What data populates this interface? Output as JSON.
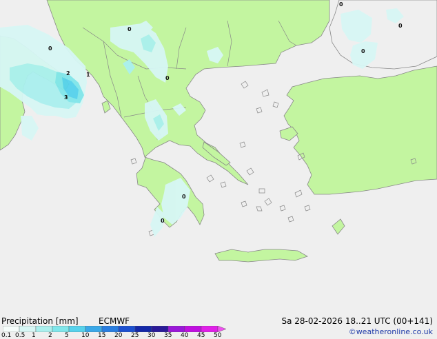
{
  "map": {
    "sea_color": "#efefef",
    "land_color": "#c3f5a0",
    "coast_color": "#888888",
    "isolines": [
      {
        "value": "0"
      },
      {
        "value": "0"
      },
      {
        "value": "0"
      },
      {
        "value": "0"
      },
      {
        "value": "0"
      },
      {
        "value": "0"
      },
      {
        "value": "0"
      },
      {
        "value": "0"
      },
      {
        "value": "2"
      },
      {
        "value": "1"
      },
      {
        "value": "3"
      }
    ]
  },
  "legend": {
    "title": "Precipitation [mm]",
    "model": "ECMWF",
    "scale": [
      {
        "label": "0.1",
        "color": "#f6fdfb"
      },
      {
        "label": "0.5",
        "color": "#d7f7f5"
      },
      {
        "label": "1",
        "color": "#aaf0ee"
      },
      {
        "label": "2",
        "color": "#80e6ea"
      },
      {
        "label": "5",
        "color": "#56d2ec"
      },
      {
        "label": "10",
        "color": "#3aa8e8"
      },
      {
        "label": "15",
        "color": "#2a7ee0"
      },
      {
        "label": "20",
        "color": "#1c50d0"
      },
      {
        "label": "25",
        "color": "#1428a8"
      },
      {
        "label": "30",
        "color": "#2a1a98"
      },
      {
        "label": "35",
        "color": "#9a18d8"
      },
      {
        "label": "40",
        "color": "#c010e0"
      },
      {
        "label": "45",
        "color": "#e020e8"
      },
      {
        "label": "50",
        "color": "#f050f0"
      }
    ]
  },
  "footer": {
    "datetime": "Sa 28-02-2026 18..21 UTC (00+141)",
    "credit": "©weatheronline.co.uk"
  }
}
